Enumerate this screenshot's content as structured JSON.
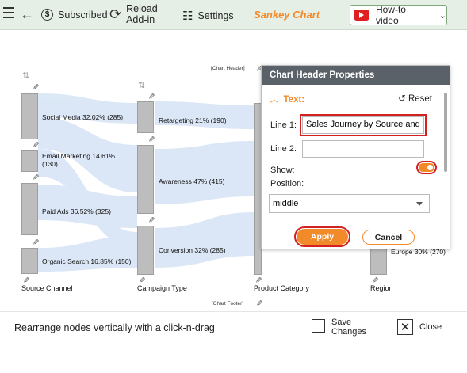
{
  "toolbar": {
    "subscribed": "Subscribed",
    "reload": "Reload\nAdd-in",
    "settings": "Settings",
    "title": "Sankey Chart",
    "howto": "How-to video"
  },
  "chart": {
    "header_tag": "[Chart Header]",
    "footer_tag": "[Chart Footer]",
    "nodes": {
      "social_media": "Social Media 32.02% (285)",
      "email_marketing": "Email Marketing 14.61%\n(130)",
      "paid_ads": "Paid Ads 36.52% (325)",
      "organic_search": "Organic Search 16.85% (150)",
      "retargeting": "Retargeting 21% (190)",
      "awareness": "Awareness 47% (415)",
      "conversion": "Conversion 32% (285)",
      "europe": "Europe 30% (270)"
    },
    "axes": {
      "source": "Source Channel",
      "campaign": "Campaign Type",
      "product": "Product Category",
      "region": "Region"
    }
  },
  "panel": {
    "title": "Chart Header Properties",
    "section": "Text:",
    "reset": "Reset",
    "line1_label": "Line 1:",
    "line1_value": "Sales Journey by Source and Region",
    "line2_label": "Line 2:",
    "line2_value": "",
    "show_label": "Show:",
    "position_label": "Position:",
    "position_value": "middle",
    "apply": "Apply",
    "cancel": "Cancel"
  },
  "footer": {
    "hint": "Rearrange nodes vertically with a click-n-drag",
    "save": "Save\nChanges",
    "close": "Close"
  },
  "colors": {
    "accent": "#f28a2a",
    "toolbar_bg": "#e6efe6",
    "flow": "#cfe0f3",
    "highlight": "#d32020"
  }
}
